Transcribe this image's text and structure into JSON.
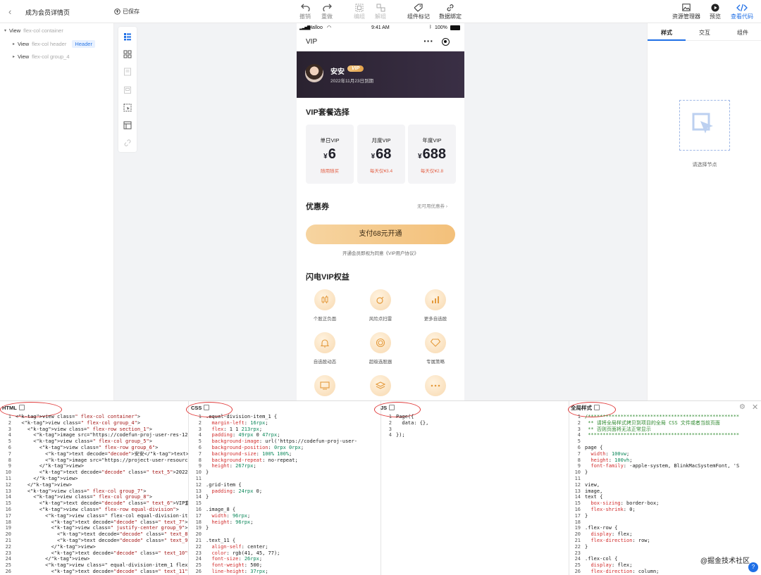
{
  "topbar": {
    "back_icon": "chevron-left-icon",
    "title": "成为会员详情页",
    "saved_label": "已保存",
    "tools": [
      {
        "label": "撤销",
        "icon": "undo-icon",
        "enabled": true
      },
      {
        "label": "重做",
        "icon": "redo-icon",
        "enabled": true
      },
      {
        "label": "编组",
        "icon": "group-icon",
        "enabled": false
      },
      {
        "label": "解组",
        "icon": "ungroup-icon",
        "enabled": false
      },
      {
        "label": "组件标记",
        "icon": "tag-icon",
        "enabled": true
      },
      {
        "label": "数据绑定",
        "icon": "link-icon",
        "enabled": true
      }
    ],
    "right_tools": [
      {
        "label": "资源管理器",
        "icon": "image-icon"
      },
      {
        "label": "预览",
        "icon": "play-icon"
      },
      {
        "label": "查看代码",
        "icon": "code-icon",
        "active": true
      }
    ]
  },
  "tree": {
    "root": {
      "name": "View",
      "cls": "flex-col container"
    },
    "children": [
      {
        "name": "View",
        "cls": "flex-col header",
        "tag": "Header"
      },
      {
        "name": "View",
        "cls": "flex-col group_4",
        "tag": ""
      }
    ]
  },
  "phone": {
    "status": {
      "carrier": "Halloo",
      "time": "9:41 AM",
      "battery": "100%"
    },
    "nav_title": "VIP",
    "user": {
      "name": "安安",
      "badge": "VIP",
      "expire": "2022年11月23日到期"
    },
    "plans_title": "VIP套餐选择",
    "plans": [
      {
        "name": "单日VIP",
        "currency": "¥",
        "price": "6",
        "sub": "随用随买"
      },
      {
        "name": "月度VIP",
        "currency": "¥",
        "price": "68",
        "sub": "每天仅¥3.4"
      },
      {
        "name": "年度VIP",
        "currency": "¥",
        "price": "688",
        "sub": "每天仅¥2.8"
      }
    ],
    "coupon_title": "优惠券",
    "coupon_hint": "无可用优惠券",
    "pay_button": "支付68元开通",
    "agreement": "开通会员即视为同意《VIP用户协议》",
    "benefits_title": "闪电VIP权益",
    "benefits": [
      {
        "label": "个股正负面",
        "icon": "candles-icon"
      },
      {
        "label": "风险点扫雷",
        "icon": "bomb-icon"
      },
      {
        "label": "更多自选股",
        "icon": "bar-chart-icon"
      },
      {
        "label": "自选股动态",
        "icon": "bell-icon"
      },
      {
        "label": "超级选股器",
        "icon": "spiral-icon"
      },
      {
        "label": "专属策略",
        "icon": "diamond-icon"
      },
      {
        "label": "",
        "icon": "monitor-icon"
      },
      {
        "label": "",
        "icon": "layers-icon"
      },
      {
        "label": "",
        "icon": "more-icon"
      }
    ]
  },
  "rpanel": {
    "tabs": [
      "样式",
      "交互",
      "组件"
    ],
    "empty_hint": "请选择节点"
  },
  "code": {
    "html_title": "HTML",
    "css_title": "CSS",
    "js_title": "JS",
    "global_title": "全局样式",
    "html_lines": [
      "<view class=\" flex-col container\">",
      "  <view class=\" flex-col group_4\">",
      "    <view class=\" flex-row section_1\">",
      "      <image src=\"https://codefun-proj-user-res-1256",
      "      <view class=\" flex-col group_5\">",
      "        <view class=\" flex-row group_6\">",
      "          <text decode=\"decode\">安安</text>",
      "          <image src=\"https://project-user-resource-",
      "        </view>",
      "        <text decode=\"decode\" class=\" text_5\">2022年",
      "      </view>",
      "    </view>",
      "    <view class=\" flex-col group_7\">",
      "      <view class=\" flex-col group_8\">",
      "        <text decode=\"decode\" class=\" text_6\">VIP套餐",
      "        <view class=\" flex-row equal-division\">",
      "          <view class=\" flex-col equal-division-item",
      "            <text decode=\"decode\" class=\" text_7\">单",
      "            <view class=\" justify-center group_9\">",
      "              <text decode=\"decode\" class=\" text_8\">",
      "              <text decode=\"decode\" class=\" text_9\">",
      "            </view>",
      "            <text decode=\"decode\" class=\" text_10\">随",
      "          </view>",
      "          <view class=\" equal-division-item_1 flex-co",
      "            <text decode=\"decode\" class=\" text_11\">月"
    ],
    "css_lines": [
      ".equal-division-item_1 {",
      "  margin-left: 16rpx;",
      "  flex: 1 1 213rpx;",
      "  padding: 49rpx 0 47rpx;",
      "  background-image: url('https://codefun-proj-user-",
      "  background-position: 0rpx 0rpx;",
      "  background-size: 100% 100%;",
      "  background-repeat: no-repeat;",
      "  height: 267rpx;",
      "}",
      "",
      ".grid-item {",
      "  padding: 24rpx 0;",
      "}",
      "",
      ".image_8 {",
      "  width: 96rpx;",
      "  height: 96rpx;",
      "}",
      "",
      ".text_11 {",
      "  align-self: center;",
      "  color: rgb(41, 45, 77);",
      "  font-size: 26rpx;",
      "  font-weight: 500;",
      "  line-height: 37rpx;"
    ],
    "js_lines": [
      "Page({",
      "  data: {},",
      "",
      "});"
    ],
    "global_lines": [
      "/***************************************************",
      " ** 请将全局样式拷贝到项目的全局 CSS 文件或者当前页面",
      " ** 否则页面将无法正常显示",
      " ***************************************************",
      "",
      "page {",
      "  width: 100vw;",
      "  height: 100vh;",
      "  font-family: -apple-system, BlinkMacSystemFont, 'S",
      "}",
      "",
      "view,",
      "image,",
      "text {",
      "  box-sizing: border-box;",
      "  flex-shrink: 0;",
      "}",
      "",
      ".flex-row {",
      "  display: flex;",
      "  flex-direction: row;",
      "}",
      "",
      ".flex-col {",
      "  display: flex;",
      "  flex-direction: column;"
    ],
    "watermark": "@掘金技术社区"
  },
  "colors": {
    "accent": "#1f6fe6",
    "hero_bg": "#2a2230",
    "pay_button": "#f5c98a",
    "price_sub": "#e4644a",
    "annotation_circle": "#e03b3b"
  }
}
